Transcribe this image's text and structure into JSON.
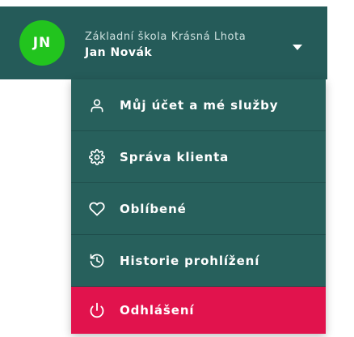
{
  "header": {
    "avatar_initials": "JN",
    "organization": "Základní škola Krásná Lhota",
    "user_name": "Jan Novák",
    "colors": {
      "header_bg": "#255b59",
      "avatar_bg": "#22c41e"
    }
  },
  "menu": {
    "items": [
      {
        "label": "Můj účet a mé služby",
        "icon": "user-icon"
      },
      {
        "label": "Správa klienta",
        "icon": "gear-icon"
      },
      {
        "label": "Oblíbené",
        "icon": "heart-icon"
      },
      {
        "label": "Historie prohlížení",
        "icon": "history-icon"
      },
      {
        "label": "Odhlášení",
        "icon": "power-icon"
      }
    ],
    "colors": {
      "menu_bg": "#27605c",
      "logout_bg": "#e1134d"
    }
  }
}
